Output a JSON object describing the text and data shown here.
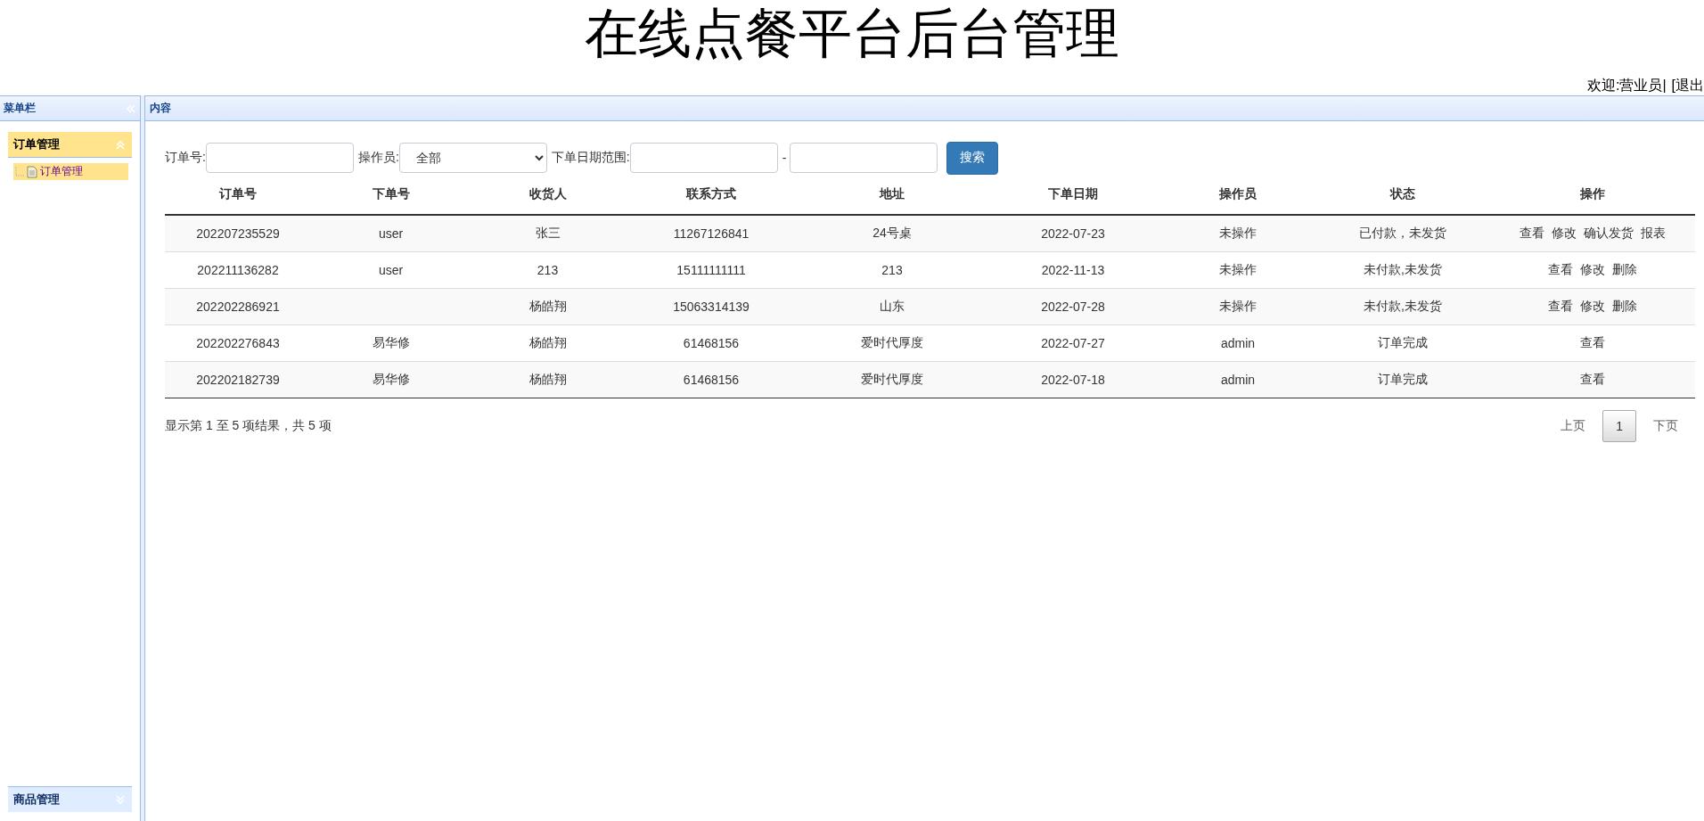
{
  "header": {
    "title": "在线点餐平台后台管理",
    "welcome": "欢迎:营业员|",
    "logout": "[退出"
  },
  "sidebar": {
    "title": "菜单栏",
    "sections": [
      {
        "label": "订单管理",
        "expanded": true,
        "items": [
          {
            "label": "订单管理",
            "selected": true
          }
        ]
      },
      {
        "label": "商品管理",
        "expanded": false
      }
    ]
  },
  "content": {
    "title": "内容",
    "filters": {
      "order_no_label": "订单号:",
      "operator_label": "操作员:",
      "operator_value": "全部",
      "date_label": "下单日期范围:",
      "date_separator": "-",
      "search_button": "搜索"
    },
    "table": {
      "columns": [
        "订单号",
        "下单号",
        "收货人",
        "联系方式",
        "地址",
        "下单日期",
        "操作员",
        "状态",
        "操作"
      ],
      "rows": [
        {
          "cells": [
            "202207235529",
            "user",
            "张三",
            "11267126841",
            "24号桌",
            "2022-07-23",
            "未操作",
            "已付款，未发货"
          ],
          "actions": [
            "查看",
            "修改",
            "确认发货",
            "报表"
          ]
        },
        {
          "cells": [
            "202211136282",
            "user",
            "213",
            "15111111111",
            "213",
            "2022-11-13",
            "未操作",
            "未付款,未发货"
          ],
          "actions": [
            "查看",
            "修改",
            "删除"
          ]
        },
        {
          "cells": [
            "202202286921",
            "",
            "杨皓翔",
            "15063314139",
            "山东",
            "2022-07-28",
            "未操作",
            "未付款,未发货"
          ],
          "actions": [
            "查看",
            "修改",
            "删除"
          ]
        },
        {
          "cells": [
            "202202276843",
            "易华修",
            "杨皓翔",
            "61468156",
            "爱时代厚度",
            "2022-07-27",
            "admin",
            "订单完成"
          ],
          "actions": [
            "查看"
          ]
        },
        {
          "cells": [
            "202202182739",
            "易华修",
            "杨皓翔",
            "61468156",
            "爱时代厚度",
            "2022-07-18",
            "admin",
            "订单完成"
          ],
          "actions": [
            "查看"
          ]
        }
      ]
    },
    "summary": "显示第 1 至 5 项结果，共 5 项",
    "pagination": {
      "prev": {
        "label": "上页",
        "disabled": true
      },
      "pages": [
        {
          "label": "1",
          "selected": true
        }
      ],
      "next": {
        "label": "下页",
        "disabled": true
      }
    }
  }
}
